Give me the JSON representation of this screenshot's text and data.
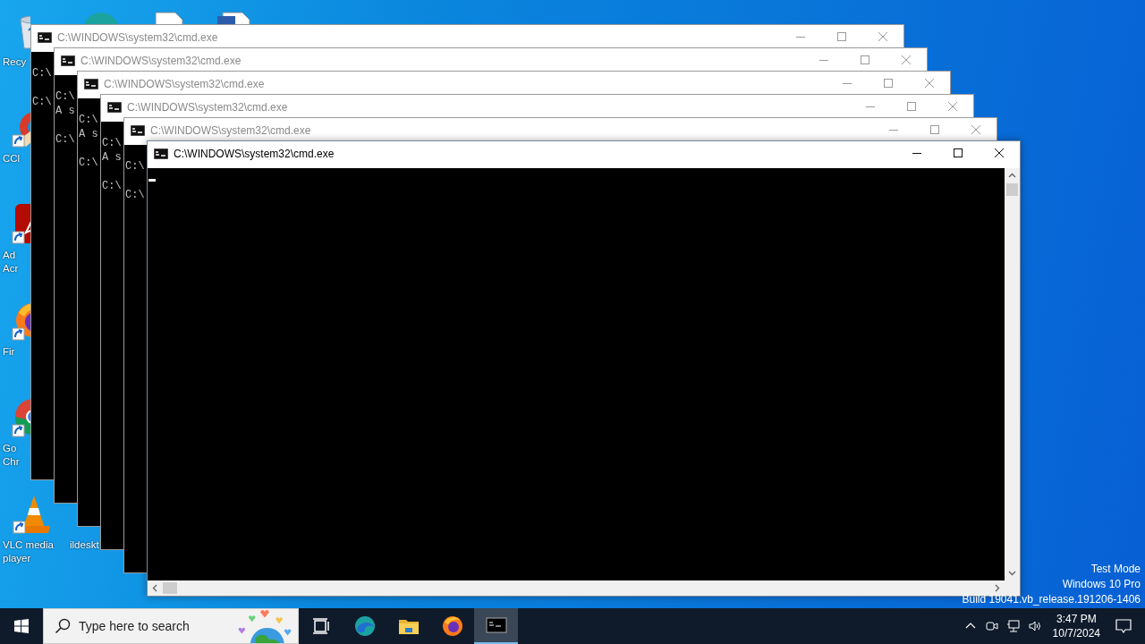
{
  "desktop": {
    "columns": [
      {
        "icons": [
          {
            "kind": "recycle-bin",
            "shortcut": false,
            "lines": [
              "Recy"
            ]
          },
          {
            "kind": "ccleaner",
            "shortcut": true,
            "lines": [
              "CCl"
            ]
          },
          {
            "kind": "acrobat",
            "shortcut": true,
            "lines": [
              "Ad",
              "Acr"
            ]
          },
          {
            "kind": "firefox",
            "shortcut": true,
            "lines": [
              "Fir"
            ]
          },
          {
            "kind": "chrome",
            "shortcut": true,
            "lines": [
              "Go",
              "Chr"
            ]
          },
          {
            "kind": "vlc",
            "shortcut": true,
            "lines": [
              "VLC media",
              "player"
            ]
          }
        ]
      },
      {
        "icons": [
          {
            "kind": "edge",
            "shortcut": false
          },
          {
            "kind": "empty"
          },
          {
            "kind": "empty"
          },
          {
            "kind": "empty"
          },
          {
            "kind": "empty"
          },
          {
            "kind": "hidden",
            "lines": [
              "ildeskt"
            ]
          }
        ]
      },
      {
        "icons": [
          {
            "kind": "document",
            "shortcut": false
          }
        ]
      },
      {
        "icons": [
          {
            "kind": "word",
            "shortcut": false
          }
        ]
      }
    ]
  },
  "windows": [
    {
      "title": "C:\\WINDOWS\\system32\\cmd.exe",
      "active": false,
      "scrollbars": false,
      "lines": [
        {
          "kind": "blank"
        },
        {
          "kind": "text",
          "text": "C:\\"
        },
        {
          "kind": "blank"
        },
        {
          "kind": "text",
          "text": "C:\\"
        }
      ]
    },
    {
      "title": "C:\\WINDOWS\\system32\\cmd.exe",
      "active": false,
      "scrollbars": false,
      "lines": [
        {
          "kind": "blank"
        },
        {
          "kind": "text",
          "text": "C:\\"
        },
        {
          "kind": "text",
          "text": "A s"
        },
        {
          "kind": "blank"
        },
        {
          "kind": "text",
          "text": "C:\\"
        }
      ]
    },
    {
      "title": "C:\\WINDOWS\\system32\\cmd.exe",
      "active": false,
      "scrollbars": false,
      "lines": [
        {
          "kind": "blank"
        },
        {
          "kind": "text",
          "text": "C:\\"
        },
        {
          "kind": "text",
          "text": "A s"
        },
        {
          "kind": "blank"
        },
        {
          "kind": "text",
          "text": "C:\\"
        }
      ]
    },
    {
      "title": "C:\\WINDOWS\\system32\\cmd.exe",
      "active": false,
      "scrollbars": false,
      "lines": [
        {
          "kind": "blank"
        },
        {
          "kind": "text",
          "text": "C:\\"
        },
        {
          "kind": "text",
          "text": "A s"
        },
        {
          "kind": "blank"
        },
        {
          "kind": "text",
          "text": "C:\\"
        }
      ]
    },
    {
      "title": "C:\\WINDOWS\\system32\\cmd.exe",
      "active": false,
      "scrollbars": false,
      "lines": [
        {
          "kind": "blank"
        },
        {
          "kind": "text",
          "text": "C:\\"
        },
        {
          "kind": "blank"
        },
        {
          "kind": "text",
          "text": "C:\\"
        }
      ]
    },
    {
      "title": "C:\\WINDOWS\\system32\\cmd.exe",
      "active": true,
      "scrollbars": true,
      "lines": [
        {
          "kind": "cursor"
        }
      ]
    }
  ],
  "watermark_text": [
    "Test Mode",
    "Windows 10 Pro",
    "Build 19041.vb_release.191206-1406"
  ],
  "taskbar": {
    "search": {
      "placeholder": "Type here to search"
    },
    "apps": [
      {
        "kind": "task-view",
        "selected": false
      },
      {
        "kind": "edge",
        "selected": false
      },
      {
        "kind": "explorer",
        "selected": false
      },
      {
        "kind": "firefox",
        "selected": false
      },
      {
        "kind": "terminal",
        "selected": true
      }
    ],
    "clock": {
      "time": "3:47 PM",
      "date": "10/7/2024"
    }
  }
}
